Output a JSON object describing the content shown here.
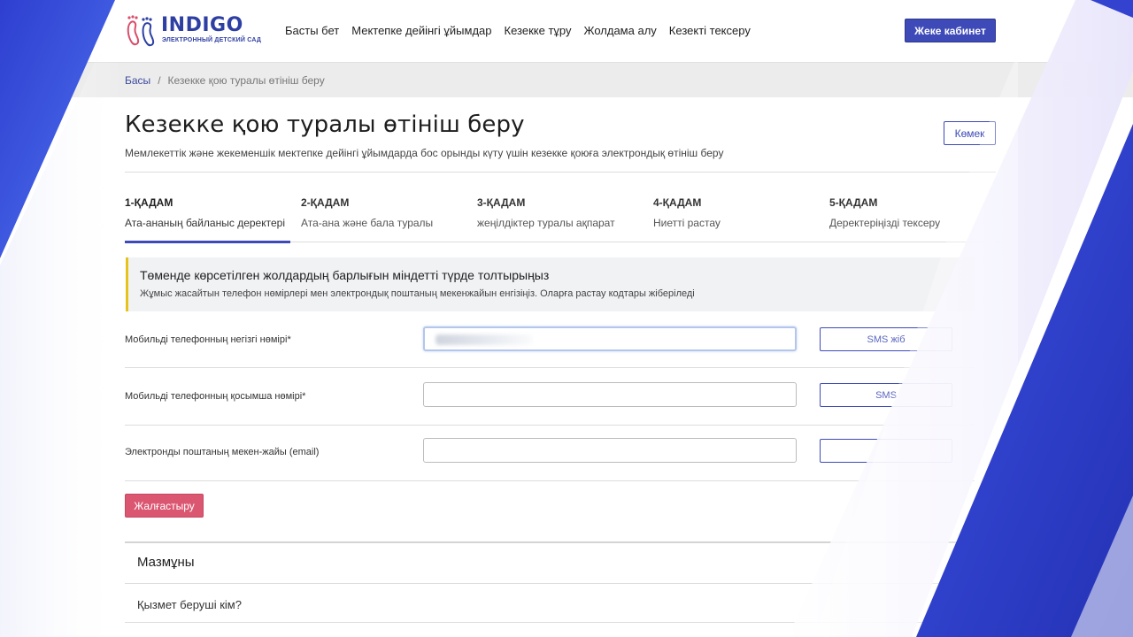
{
  "brand": {
    "name": "INDIGO",
    "subtitle": "ЭЛЕКТРОННЫЙ ДЕТСКИЙ САД",
    "color": "#2e3fa3"
  },
  "nav": {
    "items": [
      {
        "label": "Басты бет"
      },
      {
        "label": "Мектепке дейінгі ұйымдар"
      },
      {
        "label": "Кезекке тұру"
      },
      {
        "label": "Жолдама алу"
      },
      {
        "label": "Кезекті тексеру"
      }
    ],
    "cabinet_label": "Жеке кабинет"
  },
  "breadcrumb": {
    "home": "Басы",
    "separator": "/",
    "current": "Кезекке қою туралы өтініш беру"
  },
  "page": {
    "title": "Кезекке қою туралы өтініш беру",
    "subtitle": "Мемлекеттік және жекеменшік мектепке дейінгі ұйымдарда бос орынды күту үшін кезекке қоюға электрондық өтініш беру",
    "help_label": "Көмек"
  },
  "steps": [
    {
      "num": "1-ҚАДАМ",
      "label": "Ата-ананың байланыс деректері",
      "active": true
    },
    {
      "num": "2-ҚАДАМ",
      "label": "Ата-ана және бала туралы",
      "active": false
    },
    {
      "num": "3-ҚАДАМ",
      "label": "жеңілдіктер туралы ақпарат",
      "active": false
    },
    {
      "num": "4-ҚАДАМ",
      "label": "Ниетті растау",
      "active": false
    },
    {
      "num": "5-ҚАДАМ",
      "label": "Деректеріңізді тексеру",
      "active": false
    }
  ],
  "alert": {
    "title": "Төменде көрсетілген жолдардың барлығын міндетті түрде толтырыңыз",
    "text": "Жұмыс жасайтын телефон нөмірлері мен электрондық поштаның мекенжайын енгізіңіз. Оларға растау кодтары жіберіледі"
  },
  "form": {
    "rows": [
      {
        "label": "Мобильді телефонның негізгі нөмірі*",
        "value": "",
        "button": "SMS жіб"
      },
      {
        "label": "Мобильді телефонның қосымша нөмірі*",
        "value": "",
        "button": "SMS"
      },
      {
        "label": "Электронды поштаның мекен-жайы (email)",
        "value": "",
        "button": ""
      }
    ],
    "continue_label": "Жалғастыру"
  },
  "content": {
    "title": "Мазмұны",
    "question": "Қызмет беруші кім?"
  },
  "colors": {
    "primary": "#3d4ab8",
    "continue": "#db5671",
    "alert_bar": "#e8c21c"
  }
}
